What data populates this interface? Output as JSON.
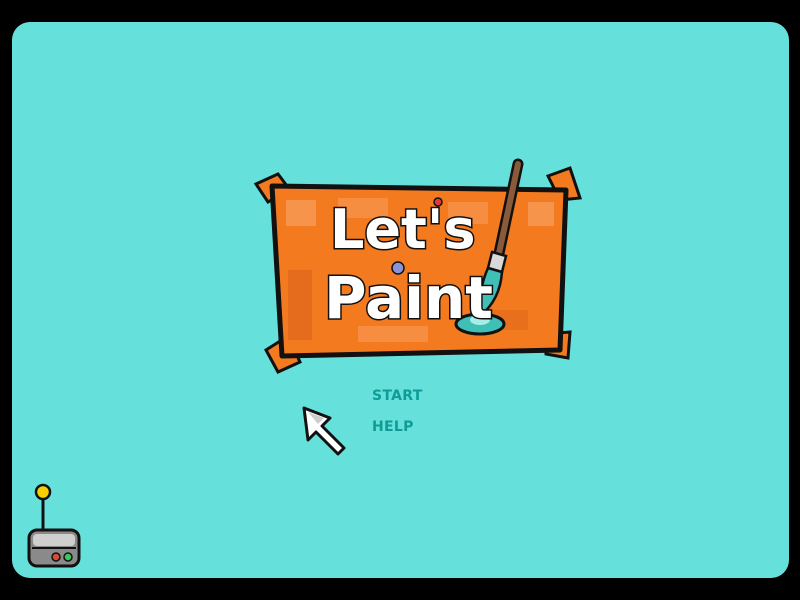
{
  "title": {
    "line1": "Let's",
    "line2": "Paint"
  },
  "menu": {
    "start_label": "START",
    "help_label": "HELP"
  },
  "icons": {
    "cursor": "pointer-arrow-icon",
    "robot": "robot-helper-icon",
    "brush": "paintbrush-icon"
  },
  "colors": {
    "background": "#66e0da",
    "frame": "#000000",
    "sign_orange": "#f47a20",
    "menu_text": "#0f9b97"
  }
}
